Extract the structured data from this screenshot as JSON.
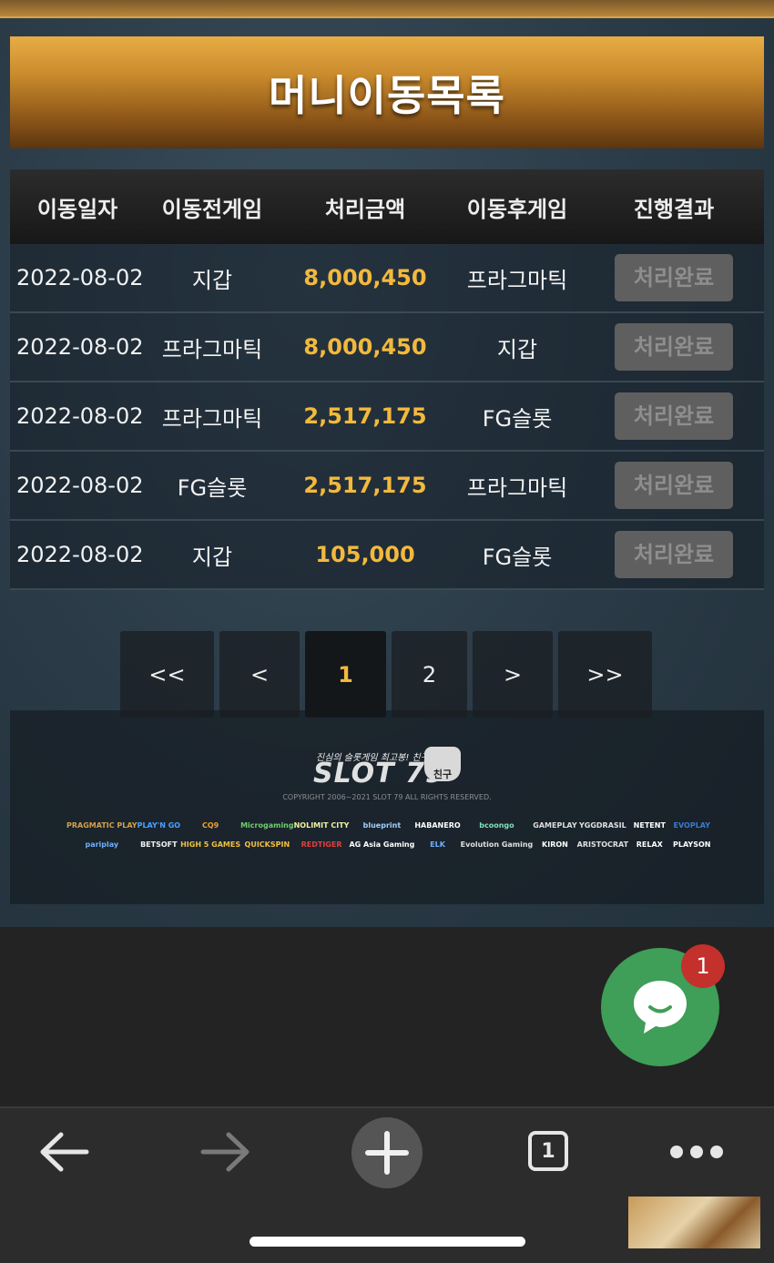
{
  "page": {
    "title": "머니이동목록"
  },
  "table": {
    "headers": [
      "이동일자",
      "이동전게임",
      "처리금액",
      "이동후게임",
      "진행결과"
    ],
    "rows": [
      {
        "date": "2022-08-02",
        "from": "지갑",
        "amount": "8,000,450",
        "to": "프라그마틱",
        "status": "처리완료"
      },
      {
        "date": "2022-08-02",
        "from": "프라그마틱",
        "amount": "8,000,450",
        "to": "지갑",
        "status": "처리완료"
      },
      {
        "date": "2022-08-02",
        "from": "프라그마틱",
        "amount": "2,517,175",
        "to": "FG슬롯",
        "status": "처리완료"
      },
      {
        "date": "2022-08-02",
        "from": "FG슬롯",
        "amount": "2,517,175",
        "to": "프라그마틱",
        "status": "처리완료"
      },
      {
        "date": "2022-08-02",
        "from": "지갑",
        "amount": "105,000",
        "to": "FG슬롯",
        "status": "처리완료"
      }
    ]
  },
  "pagination": {
    "first": "<<",
    "prev": "<",
    "pages": [
      "1",
      "2"
    ],
    "current": "1",
    "next": ">",
    "last": ">>"
  },
  "footer": {
    "tagline": "진심의 슬롯게임 최고봉! 친구슬롯",
    "logo_text": "SLOT 79",
    "logo_badge": "친구",
    "copyright": "COPYRIGHT 2006~2021 SLOT 79 ALL RIGHTS RESERVED.",
    "providers": [
      "PRAGMATIC PLAY",
      "PLAY'N GO",
      "CQ9",
      "Microgaming",
      "NOLIMIT CITY",
      "blueprint",
      "HABANERO",
      "bcoongo",
      "GAMEPLAY",
      "YGGDRASIL",
      "NETENT",
      "EVOPLAY",
      "pariplay",
      "BETSOFT",
      "HIGH 5 GAMES",
      "QUICKSPIN",
      "REDTIGER",
      "AG Asia Gaming",
      "ELK",
      "Evolution Gaming",
      "KIRON",
      "ARISTOCRAT",
      "RELAX",
      "PLAYSON"
    ]
  },
  "chat": {
    "badge_count": "1"
  },
  "browser": {
    "tab_count": "1"
  },
  "colors": {
    "amount": "#f3b93c",
    "title_gold": "#e8ad45",
    "status_button": "#5f5f5f",
    "chat_green": "#3f9e57",
    "badge_red": "#c4302b"
  }
}
